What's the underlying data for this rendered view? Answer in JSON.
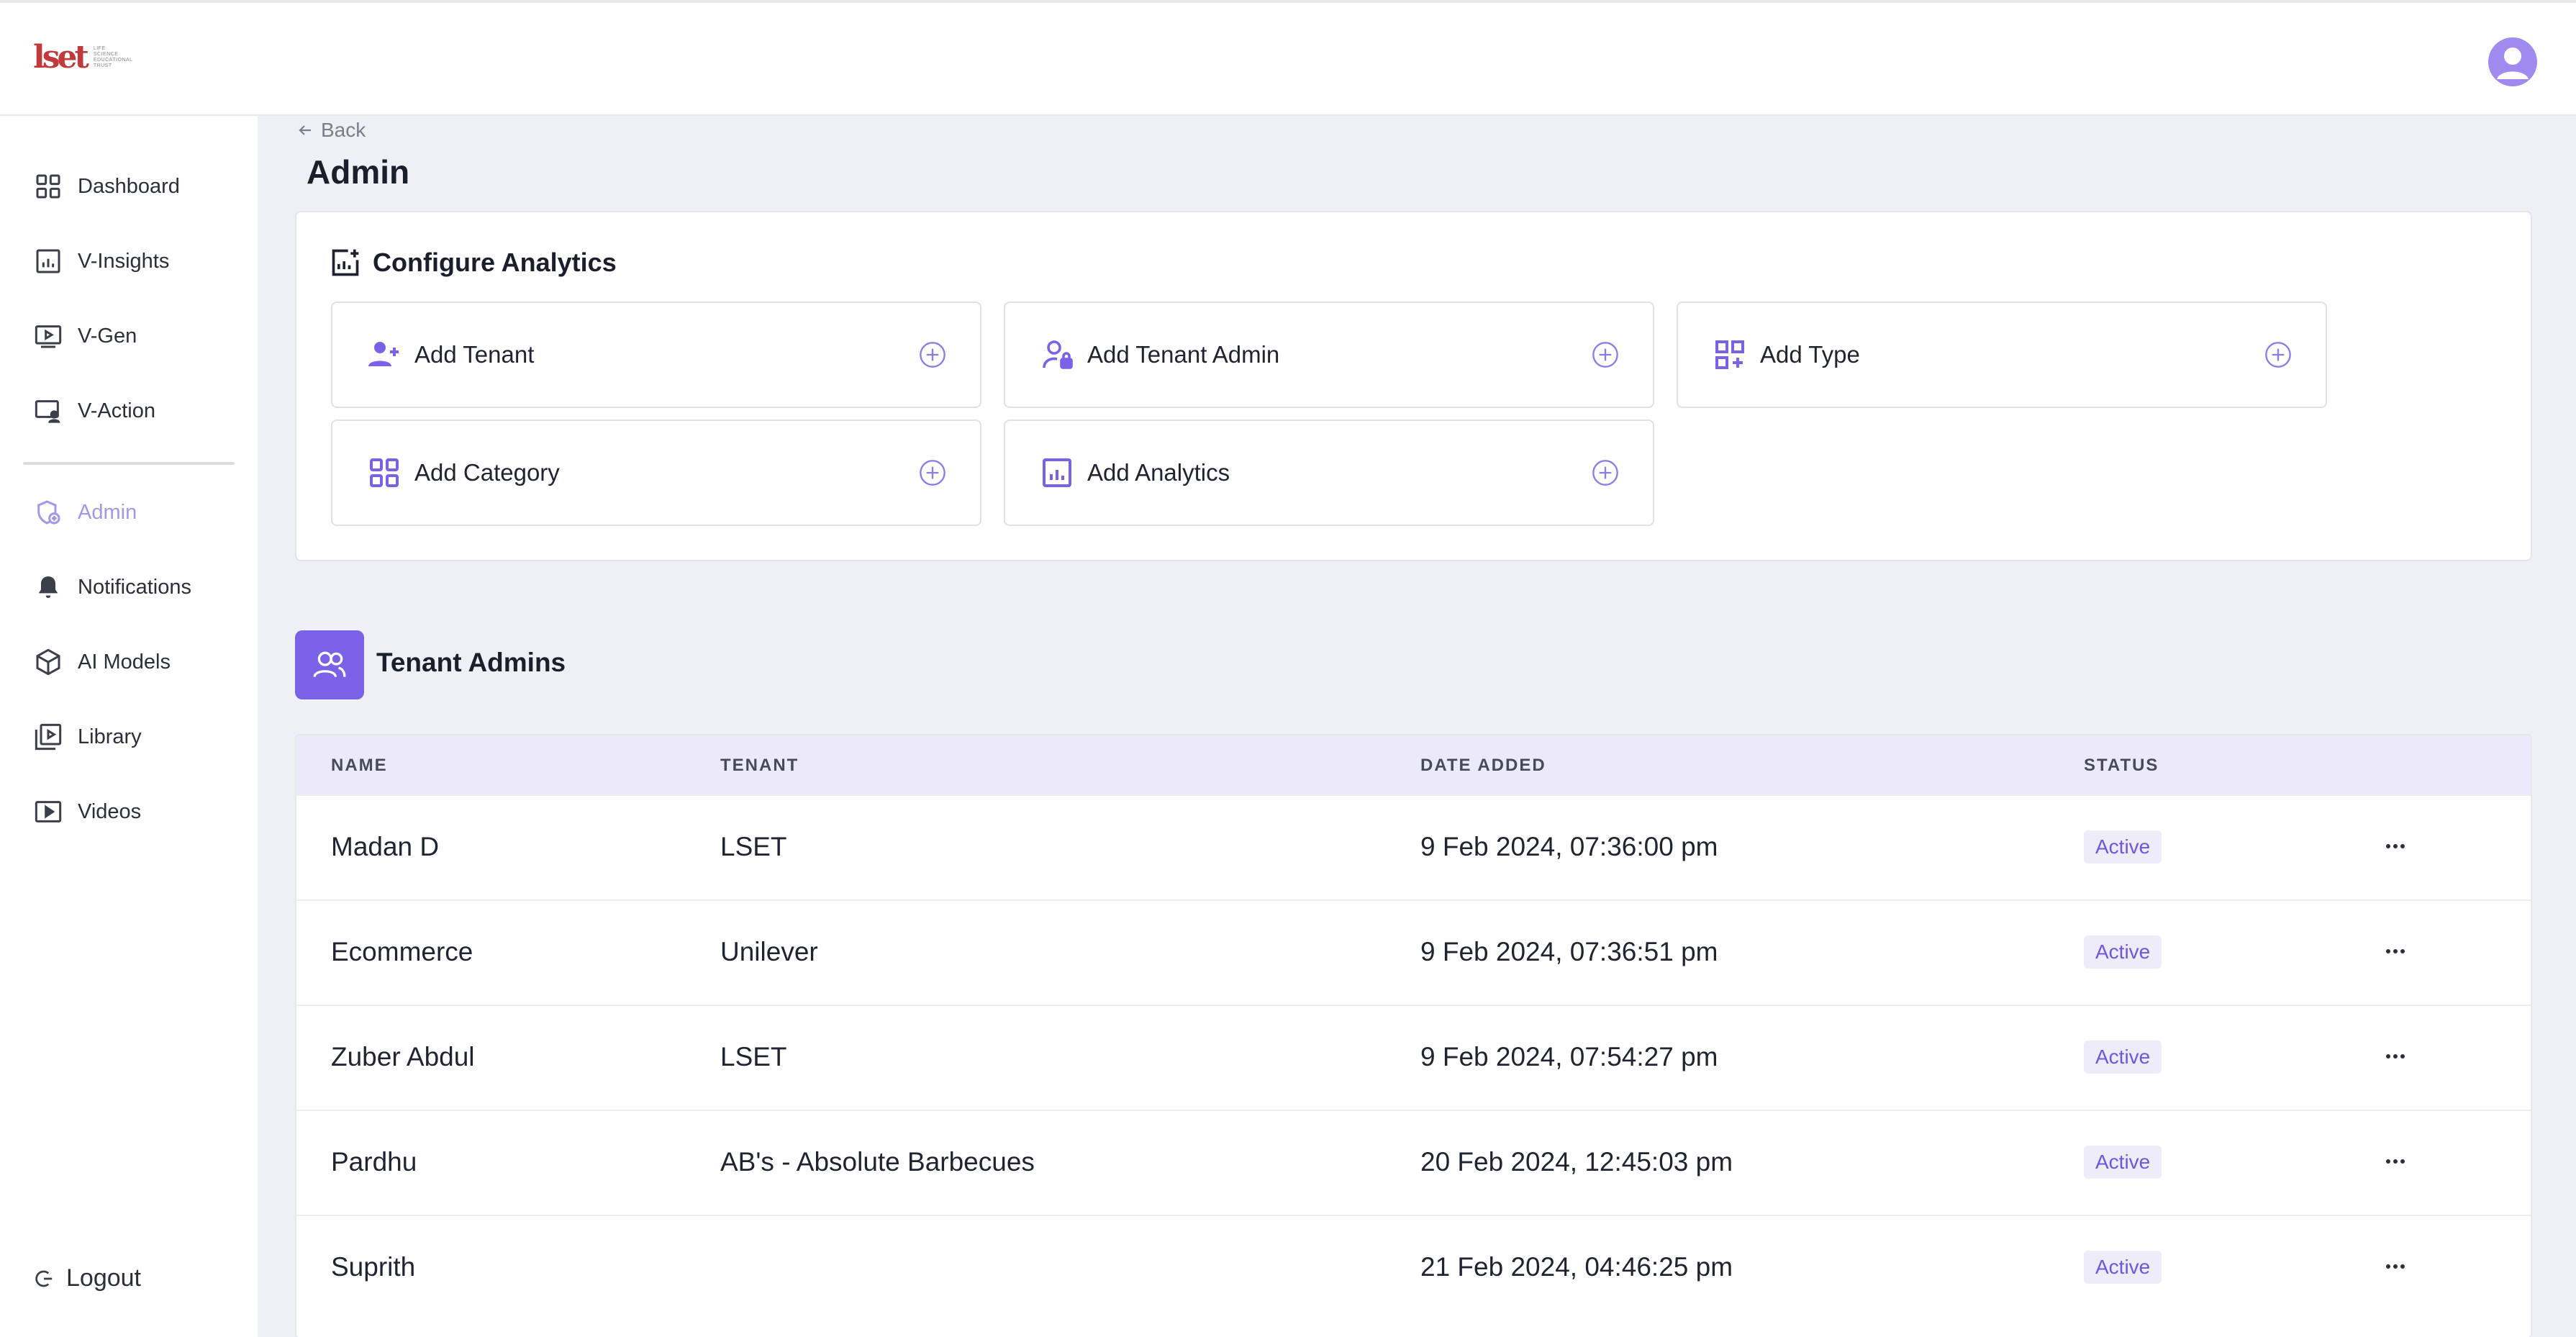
{
  "header": {
    "logo_mark": "lset",
    "logo_text": [
      "LIFE",
      "SCIENCE",
      "EDUCATIONAL",
      "TRUST"
    ]
  },
  "sidebar": {
    "items": [
      {
        "label": "Dashboard",
        "icon": "dashboard-grid-icon"
      },
      {
        "label": "V-Insights",
        "icon": "chart-icon"
      },
      {
        "label": "V-Gen",
        "icon": "video-play-icon"
      },
      {
        "label": "V-Action",
        "icon": "monitor-user-icon"
      },
      {
        "label": "Admin",
        "icon": "admin-shield-icon",
        "active": true
      },
      {
        "label": "Notifications",
        "icon": "bell-icon"
      },
      {
        "label": "AI Models",
        "icon": "cube-icon"
      },
      {
        "label": "Library",
        "icon": "library-play-icon"
      },
      {
        "label": "Videos",
        "icon": "video-icon"
      }
    ],
    "logout_label": "Logout"
  },
  "main": {
    "back_label": "Back",
    "title": "Admin",
    "configure": {
      "heading": "Configure Analytics",
      "actions": [
        {
          "label": "Add Tenant",
          "icon": "user-add-icon"
        },
        {
          "label": "Add Tenant Admin",
          "icon": "user-lock-icon"
        },
        {
          "label": "Add Type",
          "icon": "grid-add-icon"
        },
        {
          "label": "Add Category",
          "icon": "category-grid-icon"
        },
        {
          "label": "Add Analytics",
          "icon": "analytics-chart-icon"
        }
      ]
    },
    "tenant_admins": {
      "title": "Tenant Admins",
      "columns": [
        "NAME",
        "TENANT",
        "DATE ADDED",
        "STATUS"
      ],
      "rows": [
        {
          "name": "Madan D",
          "tenant": "LSET",
          "date": "9 Feb 2024, 07:36:00 pm",
          "status": "Active"
        },
        {
          "name": "Ecommerce",
          "tenant": "Unilever",
          "date": "9 Feb 2024, 07:36:51 pm",
          "status": "Active"
        },
        {
          "name": "Zuber Abdul",
          "tenant": "LSET",
          "date": "9 Feb 2024, 07:54:27 pm",
          "status": "Active"
        },
        {
          "name": "Pardhu",
          "tenant": "AB's - Absolute Barbecues",
          "date": "20 Feb 2024, 12:45:03 pm",
          "status": "Active"
        },
        {
          "name": "Suprith",
          "tenant": "",
          "date": "21 Feb 2024, 04:46:25 pm",
          "status": "Active"
        }
      ]
    }
  },
  "colors": {
    "accent": "#7b61e8",
    "accent_light": "#a597e8",
    "table_header_bg": "#ece9fb",
    "status_bg": "#eeecf8",
    "status_text": "#6f55e0"
  }
}
